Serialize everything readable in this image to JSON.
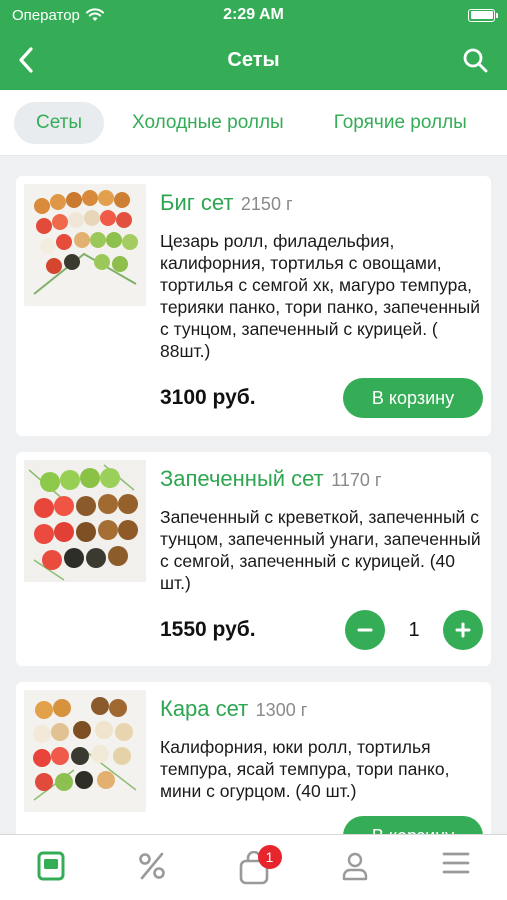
{
  "status": {
    "carrier": "Оператор",
    "time": "2:29 AM"
  },
  "header": {
    "title": "Сеты"
  },
  "tabs": [
    {
      "label": "Сеты",
      "active": true
    },
    {
      "label": "Холодные роллы",
      "active": false
    },
    {
      "label": "Горячие роллы",
      "active": false
    }
  ],
  "products": [
    {
      "name": "Биг сет",
      "weight": "2150 г",
      "description": "Цезарь ролл, филадельфия, калифорния, тортилья с овощами, тортилья с семгой хк, магуро темпура, терияки панко, тори панко, запеченный с тунцом, запеченный с курицей. ( 88шт.)",
      "price": "3100 руб.",
      "action": "В корзину"
    },
    {
      "name": "Запеченный сет",
      "weight": "1170 г",
      "description": "Запеченный с креветкой, запеченный с тунцом, запеченный унаги, запеченный с семгой, запеченный с курицей. (40 шт.)",
      "price": "1550 руб.",
      "quantity": "1"
    },
    {
      "name": "Кара сет",
      "weight": "1300 г",
      "description": "Калифорния, юки ролл, тортилья темпура, ясай темпура, тори панко, мини с огурцом. (40 шт.)",
      "price": "",
      "action": "В корзину"
    }
  ],
  "tabbar": {
    "items": [
      "menu-icon",
      "percent-icon",
      "cart-icon",
      "profile-icon",
      "hamburger-icon"
    ],
    "cart_badge": "1"
  },
  "colors": {
    "accent": "#35ad57",
    "badge": "#e6252c"
  }
}
